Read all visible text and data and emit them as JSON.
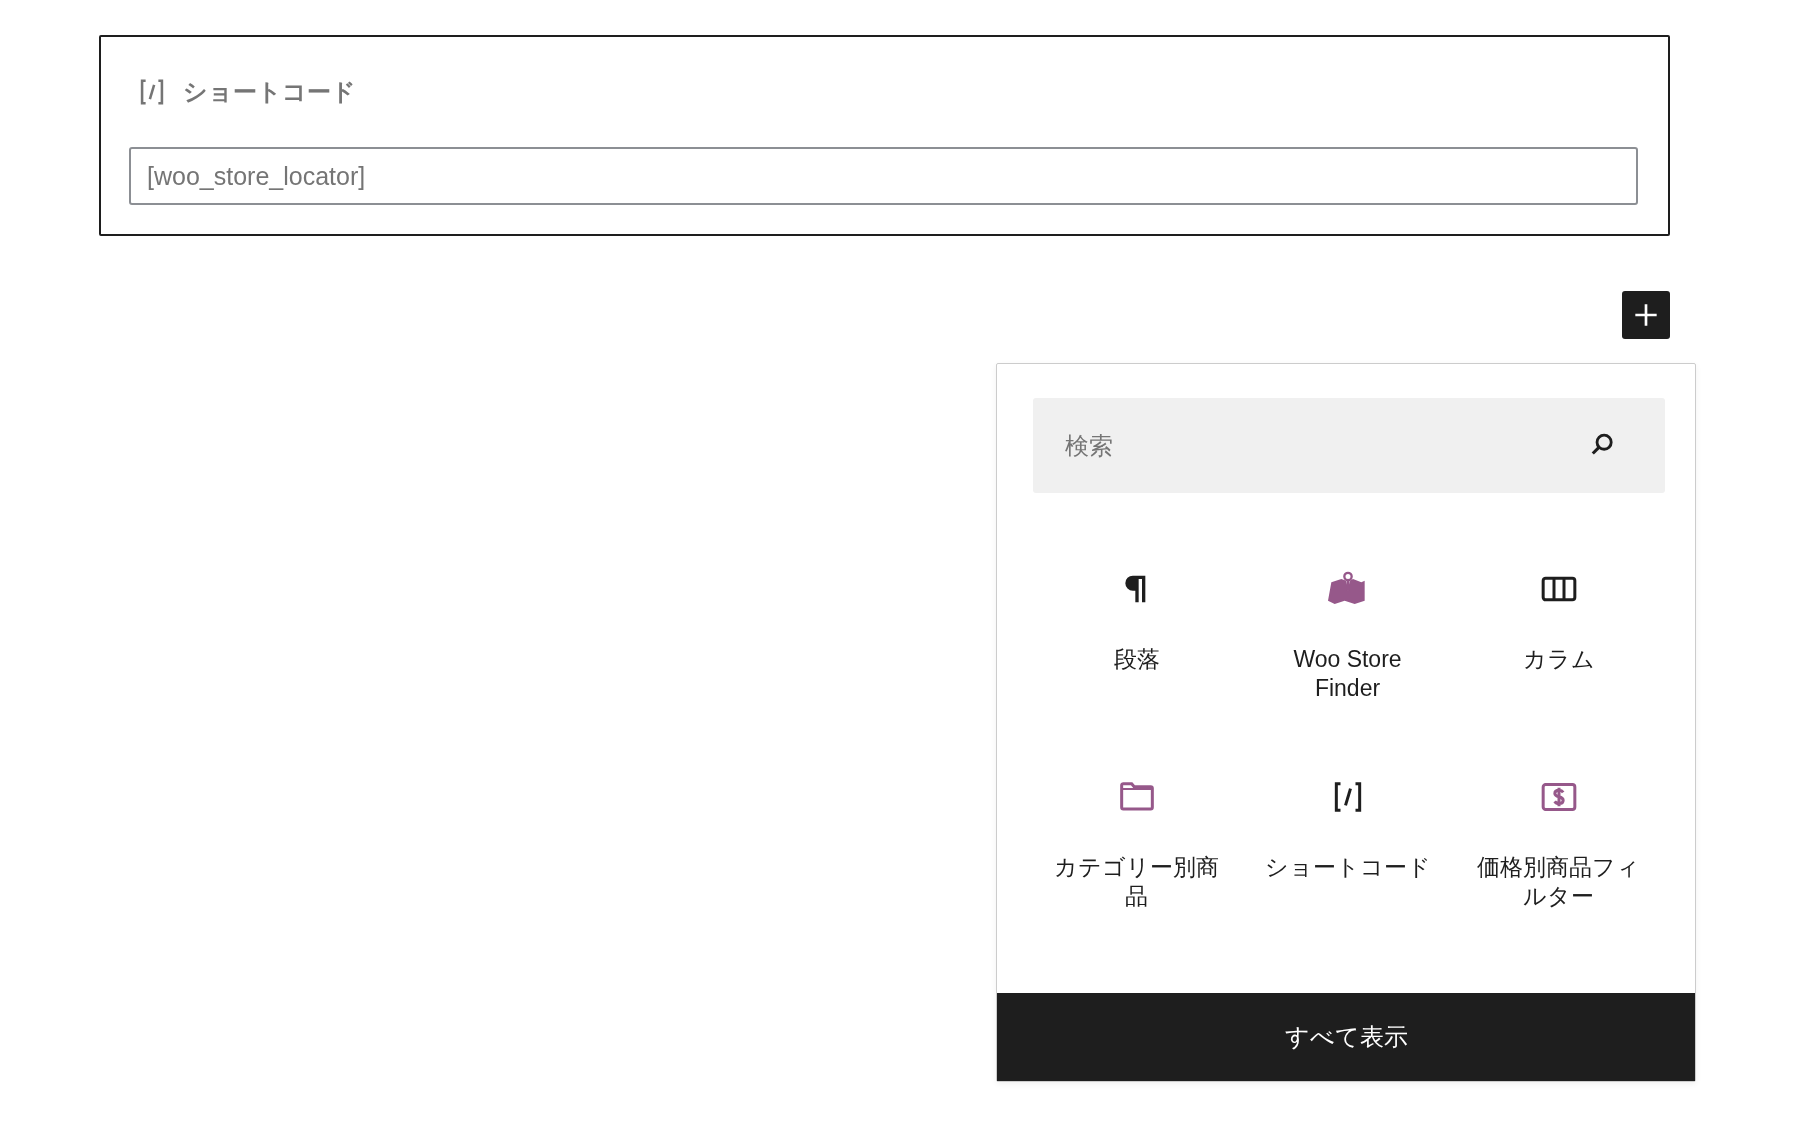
{
  "shortcode_block": {
    "title": "ショートコード",
    "value": "[woo_store_locator]"
  },
  "inserter": {
    "search": {
      "placeholder": "検索"
    },
    "blocks": [
      {
        "kind": "paragraph",
        "label": "段落"
      },
      {
        "kind": "map",
        "label": "Woo Store Finder"
      },
      {
        "kind": "columns",
        "label": "カラム"
      },
      {
        "kind": "folder",
        "label": "カテゴリー別商品"
      },
      {
        "kind": "shortcode",
        "label": "ショートコード"
      },
      {
        "kind": "price",
        "label": "価格別商品フィルター"
      }
    ],
    "show_all": "すべて表示"
  }
}
